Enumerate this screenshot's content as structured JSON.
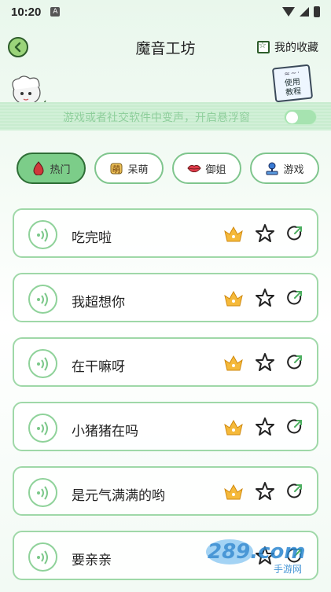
{
  "status_bar": {
    "time": "10:20",
    "notification_icon": "A"
  },
  "header": {
    "title": "魔音工坊",
    "favorites_label": "我的收藏"
  },
  "tutorial": {
    "line1": "使用",
    "line2": "教程"
  },
  "float_banner": {
    "text": "游戏或者社交软件中变声，开启悬浮窗",
    "toggle_on": false
  },
  "categories": [
    {
      "label": "热门",
      "icon": "fire-drop-icon",
      "active": true
    },
    {
      "label": "呆萌",
      "icon": "cute-icon",
      "active": false
    },
    {
      "label": "御姐",
      "icon": "lips-icon",
      "active": false
    },
    {
      "label": "游戏",
      "icon": "joystick-icon",
      "active": false
    }
  ],
  "sounds": [
    {
      "title": "吃完啦"
    },
    {
      "title": "我超想你"
    },
    {
      "title": "在干嘛呀"
    },
    {
      "title": "小猪猪在吗"
    },
    {
      "title": "是元气满满的哟"
    },
    {
      "title": "要亲亲"
    }
  ],
  "watermark": {
    "text": "289.com",
    "sub": "手游网"
  },
  "colors": {
    "accent_green": "#7ccd89",
    "border_green": "#9fd8a8",
    "vip_gold": "#f5b93a",
    "dark_outline": "#2e6e36"
  }
}
